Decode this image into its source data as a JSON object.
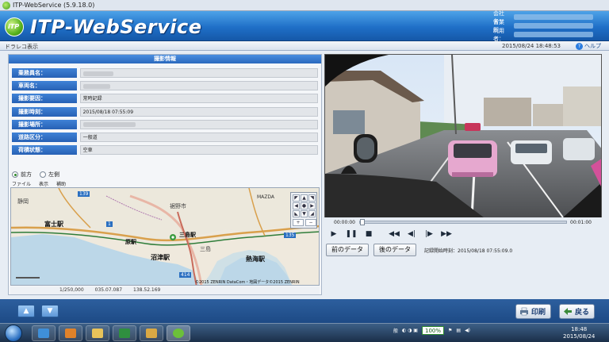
{
  "window": {
    "title": "ITP-WebService (5.9.18.0)"
  },
  "header": {
    "logo_text": "iTP",
    "app_name": "ITP-WebService",
    "user_info": [
      {
        "label": "会社名："
      },
      {
        "label": "営業所："
      },
      {
        "label": "利用者："
      }
    ]
  },
  "subbar": {
    "breadcrumb": "ドラレコ表示",
    "datetime": "2015/08/24 18:48:53",
    "help_label": "ヘルプ"
  },
  "info_panel": {
    "title": "撮影情報",
    "rows": [
      {
        "label": "乗務員名：",
        "value": ""
      },
      {
        "label": "車両名：",
        "value": ""
      },
      {
        "label": "撮影要因：",
        "value": "常時記録"
      },
      {
        "label": "撮影時刻：",
        "value": "2015/08/18 07:55:09"
      },
      {
        "label": "撮影場所：",
        "value": ""
      },
      {
        "label": "道路区分：",
        "value": "一般道"
      },
      {
        "label": "荷積状態：",
        "value": "空車"
      }
    ]
  },
  "view_options": {
    "front": "前方",
    "left": "左側"
  },
  "map_menu": [
    "ファイル",
    "表示",
    "補助"
  ],
  "map": {
    "labels": [
      "富士駅",
      "原駅",
      "沼津駅",
      "三島駅",
      "熱海駅",
      "静岡",
      "裾野市",
      "三島",
      "414",
      "1",
      "135",
      "139",
      "MAZDA"
    ],
    "copyright": "©2015 ZENRIN DataCom・地図データ©2015 ZENRIN",
    "scale": "1/250,000",
    "lat": "035.07.087",
    "lon": "138.52.169"
  },
  "player": {
    "current_time": "00:00:00",
    "total_time": "00:01:00",
    "progress": 0.0,
    "prev_data": "前のデータ",
    "next_data": "後のデータ",
    "record_start": "記録開始時刻：2015/08/18 07:55:09.0"
  },
  "actions": {
    "print": "印刷",
    "back": "戻る"
  },
  "taskbar": {
    "battery": "100%",
    "time": "18:48",
    "date": "2015/08/24"
  }
}
